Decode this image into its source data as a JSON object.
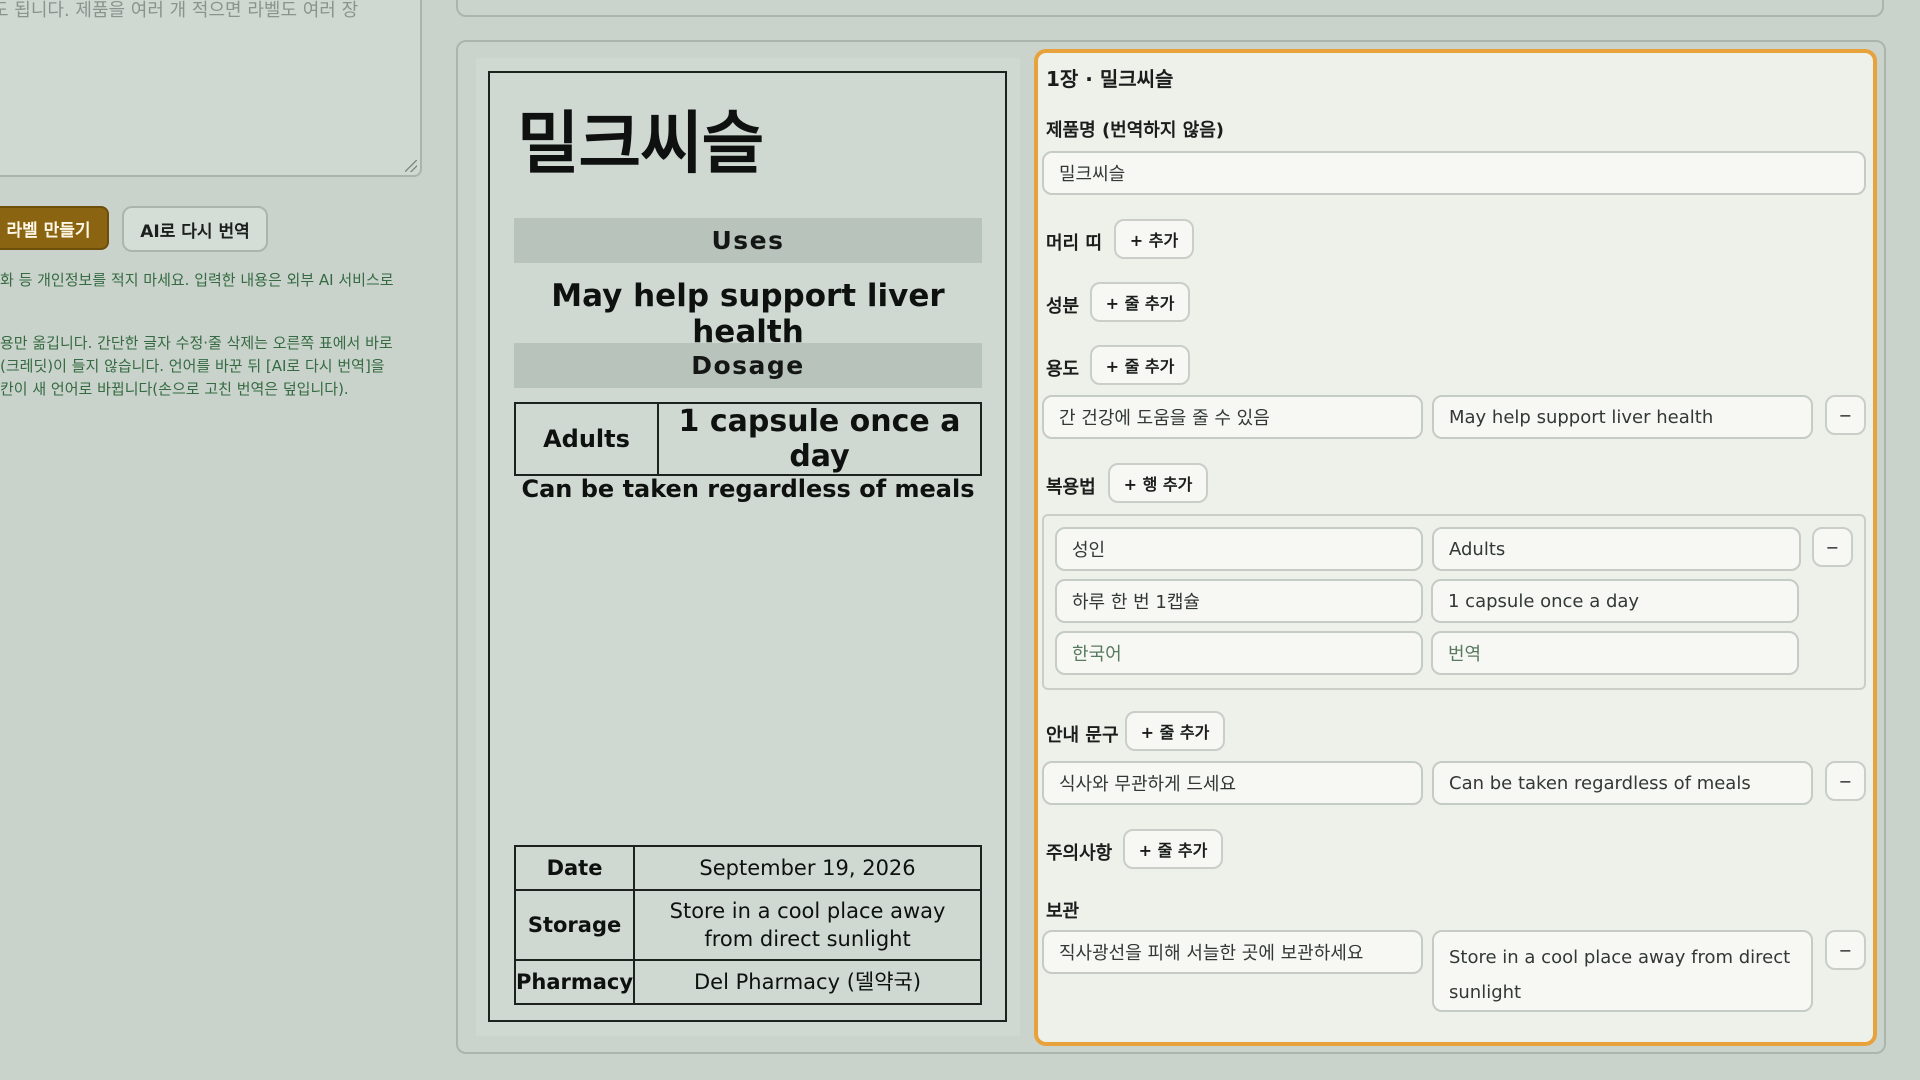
{
  "left": {
    "textarea_line1": "도 됩니다. 제품을 여러 개 적으면 라벨도 여러 장",
    "textarea_line2": ".",
    "make_label_button": "라벨 만들기",
    "retranslate_button": "AI로 다시 번역",
    "privacy_note": "화 등 개인정보를 적지 마세요. 입력한 내용은 외부 AI 서비스로",
    "help_lines": [
      "용만 옮깁니다. 간단한 글자 수정·줄 삭제는 오른쪽 표에서 바로",
      "(크레딧)이 들지 않습니다. 언어를 바꾼 뒤 [AI로 다시 번역]을",
      "칸이 새 언어로 바뀝니다(손으로 고친 번역은 덮입니다)."
    ]
  },
  "preview": {
    "product_name": "밀크씨슬",
    "uses_header": "Uses",
    "uses_text": "May help support liver health",
    "dosage_header": "Dosage",
    "dosage_rows": [
      {
        "key": "Adults",
        "value": "1 capsule once a day"
      }
    ],
    "dosage_note": "Can be taken regardless of meals",
    "info_rows": [
      {
        "key": "Date",
        "value": "September 19, 2026"
      },
      {
        "key": "Storage",
        "value": "Store in a cool place away from direct sunlight"
      },
      {
        "key": "Pharmacy",
        "value": "Del Pharmacy (델약국)"
      }
    ]
  },
  "editor": {
    "title": "1장 · 밀크씨슬",
    "product_name_label": "제품명 (번역하지 않음)",
    "product_name_value": "밀크씨슬",
    "headband_label": "머리 띠",
    "add_label": "+ 추가",
    "ingredients_label": "성분",
    "add_line_label": "+ 줄 추가",
    "uses_label": "용도",
    "uses_ko": "간 건강에 도움을 줄 수 있음",
    "uses_en": "May help support liver health",
    "dosage_label": "복용법",
    "add_row_label": "+ 행 추가",
    "dosage_who_ko": "성인",
    "dosage_who_en": "Adults",
    "dosage_amount_ko": "하루 한 번 1캡슐",
    "dosage_amount_en": "1 capsule once a day",
    "dosage_new_ko_placeholder": "한국어",
    "dosage_new_en_placeholder": "번역",
    "guide_label": "안내 문구",
    "guide_ko": "식사와 무관하게 드세요",
    "guide_en": "Can be taken regardless of meals",
    "caution_label": "주의사항",
    "storage_label": "보관",
    "storage_ko": "직사광선을 피해 서늘한 곳에 보관하세요",
    "storage_en": "Store in a cool place away from direct sunlight",
    "remove_symbol": "−"
  }
}
